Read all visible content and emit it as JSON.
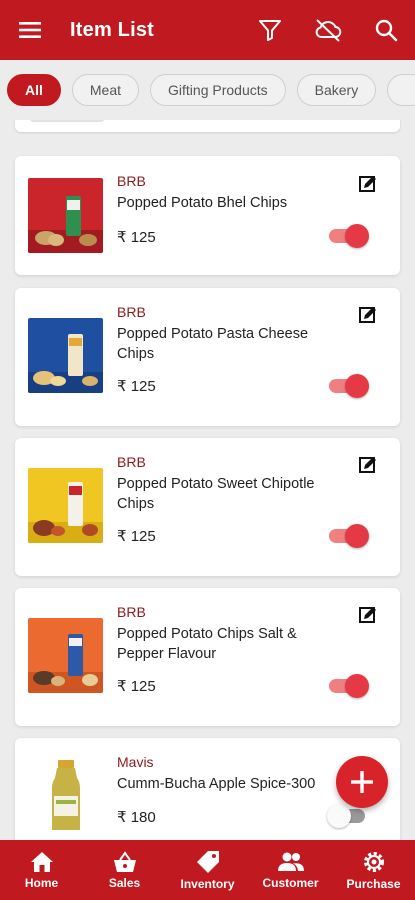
{
  "appbar": {
    "title": "Item List",
    "icons": [
      "menu-icon",
      "filter-icon",
      "cloud-off-icon",
      "search-icon"
    ],
    "color": "#c0191f"
  },
  "categories": [
    {
      "label": "All",
      "active": true
    },
    {
      "label": "Meat",
      "active": false
    },
    {
      "label": "Gifting Products",
      "active": false
    },
    {
      "label": "Bakery",
      "active": false
    },
    {
      "label": "",
      "active": false
    }
  ],
  "items": [
    {
      "brand": "BRB",
      "name": "Popped Potato Bhel Chips",
      "price": "₹ 125",
      "enabled": true,
      "image_bg": "#c9252b"
    },
    {
      "brand": "BRB",
      "name": "Popped Potato Pasta Cheese Chips",
      "price": "₹ 125",
      "enabled": true,
      "image_bg": "#1f4fa0"
    },
    {
      "brand": "BRB",
      "name": "Popped Potato Sweet Chipotle Chips",
      "price": "₹ 125",
      "enabled": true,
      "image_bg": "#f0c623"
    },
    {
      "brand": "BRB",
      "name": "Popped Potato Chips Salt & Pepper Flavour",
      "price": "₹ 125",
      "enabled": true,
      "image_bg": "#ea6a2f"
    },
    {
      "brand": "Mavis",
      "name": "Cumm-Bucha Apple Spice-300",
      "price": "₹ 180",
      "enabled": false,
      "image_bg": "#ffffff"
    }
  ],
  "bottom_nav": [
    {
      "label": "Home",
      "icon": "home-icon"
    },
    {
      "label": "Sales",
      "icon": "basket-icon"
    },
    {
      "label": "Inventory",
      "icon": "tag-icon",
      "active": true
    },
    {
      "label": "Customer",
      "icon": "people-icon"
    },
    {
      "label": "Purchase",
      "icon": "gear-icon"
    }
  ],
  "fab": {
    "icon": "plus-icon"
  }
}
